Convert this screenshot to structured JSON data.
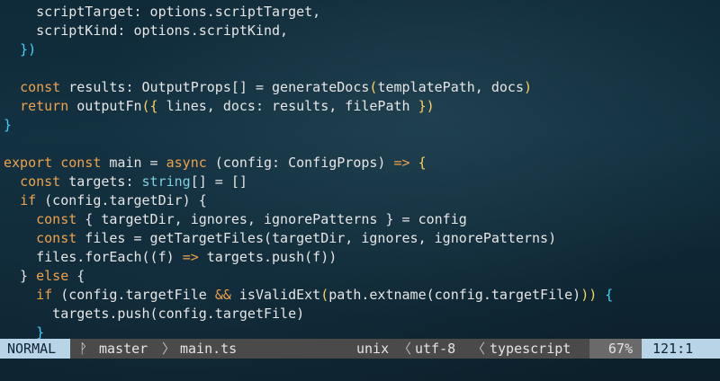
{
  "colors": {
    "plain": "#e6e6e6",
    "keyword": "#f0a24a",
    "type": "#7fd1dc",
    "func": "#ffd25c",
    "punct": "#e6e6e6",
    "bracket": "#45d0ff",
    "operator": "#f0a24a"
  },
  "code": {
    "lines": [
      [
        [
          "    scriptTarget: options.scriptTarget,",
          "plain"
        ]
      ],
      [
        [
          "    scriptKind: options.scriptKind,",
          "plain"
        ]
      ],
      [
        [
          "  })",
          "bracket"
        ]
      ],
      [
        [
          "",
          "plain"
        ]
      ],
      [
        [
          "  ",
          "plain"
        ],
        [
          "const",
          "keyword"
        ],
        [
          " results: ",
          "plain"
        ],
        [
          "OutputProps[]",
          "plain"
        ],
        [
          " = ",
          "plain"
        ],
        [
          "generateDocs",
          "plain"
        ],
        [
          "(",
          "func"
        ],
        [
          "templatePath, docs",
          "plain"
        ],
        [
          ")",
          "func"
        ]
      ],
      [
        [
          "  ",
          "plain"
        ],
        [
          "return",
          "keyword"
        ],
        [
          " outputFn",
          "plain"
        ],
        [
          "({",
          "func"
        ],
        [
          " lines, docs: results, filePath ",
          "plain"
        ],
        [
          "})",
          "func"
        ]
      ],
      [
        [
          "}",
          "bracket"
        ]
      ],
      [
        [
          "",
          "plain"
        ]
      ],
      [
        [
          "export",
          "keyword"
        ],
        [
          " ",
          "plain"
        ],
        [
          "const",
          "keyword"
        ],
        [
          " main = ",
          "plain"
        ],
        [
          "async",
          "keyword"
        ],
        [
          " (config: ConfigProps) ",
          "plain"
        ],
        [
          "=>",
          "keyword"
        ],
        [
          " {",
          "func"
        ]
      ],
      [
        [
          "  ",
          "plain"
        ],
        [
          "const",
          "keyword"
        ],
        [
          " targets: ",
          "plain"
        ],
        [
          "string",
          "type"
        ],
        [
          "[] = []",
          "plain"
        ]
      ],
      [
        [
          "  ",
          "plain"
        ],
        [
          "if",
          "keyword"
        ],
        [
          " (config.targetDir) {",
          "plain"
        ]
      ],
      [
        [
          "    ",
          "plain"
        ],
        [
          "const",
          "keyword"
        ],
        [
          " { targetDir, ignores, ignorePatterns } = config",
          "plain"
        ]
      ],
      [
        [
          "    ",
          "plain"
        ],
        [
          "const",
          "keyword"
        ],
        [
          " files = getTargetFiles(targetDir, ignores, ignorePatterns)",
          "plain"
        ]
      ],
      [
        [
          "    files.forEach((f) ",
          "plain"
        ],
        [
          "=>",
          "keyword"
        ],
        [
          " targets.push(f))",
          "plain"
        ]
      ],
      [
        [
          "  } ",
          "plain"
        ],
        [
          "else",
          "keyword"
        ],
        [
          " {",
          "plain"
        ]
      ],
      [
        [
          "    ",
          "plain"
        ],
        [
          "if",
          "keyword"
        ],
        [
          " (config.targetFile ",
          "plain"
        ],
        [
          "&&",
          "keyword"
        ],
        [
          " isValidExt",
          "plain"
        ],
        [
          "(",
          "func"
        ],
        [
          "path.extname(config.targetFile)",
          "plain"
        ],
        [
          "))",
          "func"
        ],
        [
          " {",
          "bracket"
        ]
      ],
      [
        [
          "      targets.push(config.targetFile)",
          "plain"
        ]
      ],
      [
        [
          "    }",
          "bracket"
        ]
      ]
    ]
  },
  "statusbar": {
    "mode": "NORMAL",
    "branch_icon": "git-branch-icon",
    "branch_glyph": "ᚹ",
    "branch": "master",
    "crumb_sep": "〉",
    "file": "main.ts",
    "fileformat": "unix",
    "sep": "〈",
    "encoding": "utf-8",
    "filetype": "typescript",
    "percent": "67%",
    "position": "121:1"
  }
}
